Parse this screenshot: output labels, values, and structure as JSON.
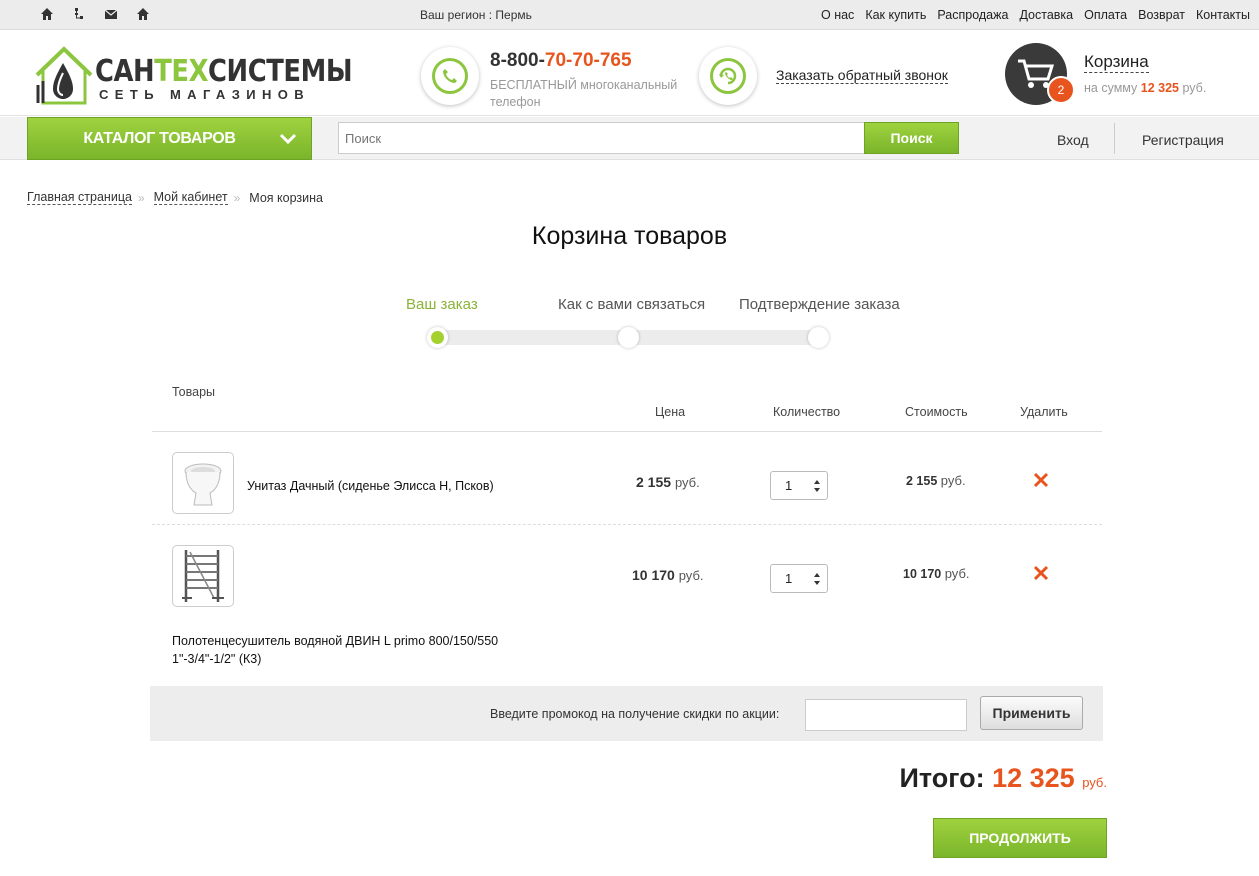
{
  "topbar": {
    "icons": [
      "home-icon",
      "sitemap-icon",
      "mail-icon",
      "home-alt-icon"
    ],
    "region_label": "Ваш регион :",
    "region_value": "Пермь",
    "nav": [
      "О нас",
      "Как купить",
      "Распродажа",
      "Доставка",
      "Оплата",
      "Возврат",
      "Контакты"
    ]
  },
  "header": {
    "logo_brand_a": "САН",
    "logo_brand_b": "ТЕХ",
    "logo_brand_c": "СИСТЕМЫ",
    "logo_sub": "СЕТЬ МАГАЗИНОВ",
    "phone_prefix": "8-800-",
    "phone_main": "70-70-765",
    "phone_desc": "БЕСПЛАТНЫЙ многоканальный телефон",
    "callback": "Заказать обратный звонок",
    "cart_count": "2",
    "cart_title": "Корзина",
    "cart_sum_label": "на сумму",
    "cart_sum_value": "12 325",
    "cart_sum_currency": "руб."
  },
  "navbar": {
    "catalog_label": "КАТАЛОГ ТОВАРОВ",
    "search_placeholder": "Поиск",
    "search_button": "Поиск",
    "login": "Вход",
    "register": "Регистрация"
  },
  "breadcrumb": {
    "items": [
      "Главная страница",
      "Мой кабинет"
    ],
    "current": "Моя корзина"
  },
  "page_title": "Корзина товаров",
  "steps": [
    {
      "label": "Ваш заказ",
      "active": true
    },
    {
      "label": "Как с вами связаться",
      "active": false
    },
    {
      "label": "Подтверждение заказа",
      "active": false
    }
  ],
  "table": {
    "headers": {
      "goods": "Товары",
      "price": "Цена",
      "qty": "Количество",
      "cost": "Стоимость",
      "delete": "Удалить"
    },
    "rows": [
      {
        "name": "Унитаз Дачный (сиденье Элисса Н, Псков)",
        "price": "2 155",
        "currency": "руб.",
        "qty": "1",
        "cost": "2 155",
        "thumb": "toilet-thumbnail"
      },
      {
        "name": "Полотенцесушитель водяной ДВИН L primo 800/150/550 1\"-3/4\"-1/2\" (К3)",
        "price": "10 170",
        "currency": "руб.",
        "qty": "1",
        "cost": "10 170",
        "thumb": "towel-dryer-thumbnail"
      }
    ]
  },
  "promo": {
    "label": "Введите промокод на получение скидки по акции:",
    "value": "",
    "button": "Применить"
  },
  "total": {
    "label": "Итого:",
    "value": "12 325",
    "currency": "руб."
  },
  "continue_button": "ПРОДОЛЖИТЬ",
  "colors": {
    "accent_green": "#8cc63f",
    "accent_orange": "#e8541e"
  }
}
